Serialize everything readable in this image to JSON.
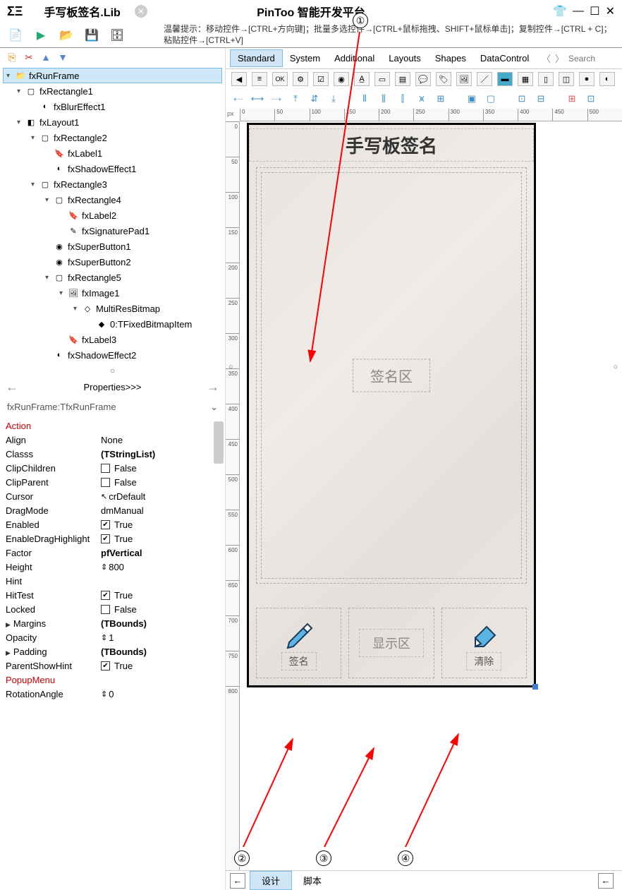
{
  "titlebar": {
    "file": "手写板签名.Lib",
    "app": "PinToo 智能开发平台"
  },
  "hint": "温馨提示：移动控件→[CTRL+方向键]；批量多选控件→[CTRL+鼠标拖拽、SHIFT+鼠标单击]；复制控件→[CTRL + C]；粘贴控件→[CTRL+V]",
  "tree": [
    {
      "lvl": 0,
      "exp": "▾",
      "icon": "📁",
      "label": "fxRunFrame",
      "sel": true
    },
    {
      "lvl": 1,
      "exp": "▾",
      "icon": "▢",
      "label": "fxRectangle1"
    },
    {
      "lvl": 2,
      "exp": "",
      "icon": "◐",
      "label": "fxBlurEffect1"
    },
    {
      "lvl": 1,
      "exp": "▾",
      "icon": "◧",
      "label": "fxLayout1"
    },
    {
      "lvl": 2,
      "exp": "▾",
      "icon": "▢",
      "label": "fxRectangle2"
    },
    {
      "lvl": 3,
      "exp": "",
      "icon": "🔖",
      "label": "fxLabel1"
    },
    {
      "lvl": 3,
      "exp": "",
      "icon": "◐",
      "label": "fxShadowEffect1"
    },
    {
      "lvl": 2,
      "exp": "▾",
      "icon": "▢",
      "label": "fxRectangle3"
    },
    {
      "lvl": 3,
      "exp": "▾",
      "icon": "▢",
      "label": "fxRectangle4"
    },
    {
      "lvl": 4,
      "exp": "",
      "icon": "🔖",
      "label": "fxLabel2"
    },
    {
      "lvl": 4,
      "exp": "",
      "icon": "✎",
      "label": "fxSignaturePad1"
    },
    {
      "lvl": 3,
      "exp": "",
      "icon": "◉",
      "label": "fxSuperButton1"
    },
    {
      "lvl": 3,
      "exp": "",
      "icon": "◉",
      "label": "fxSuperButton2"
    },
    {
      "lvl": 3,
      "exp": "▾",
      "icon": "▢",
      "label": "fxRectangle5"
    },
    {
      "lvl": 4,
      "exp": "▾",
      "icon": "🖼",
      "label": "fxImage1"
    },
    {
      "lvl": 5,
      "exp": "▾",
      "icon": "◇",
      "label": "MultiResBitmap"
    },
    {
      "lvl": 6,
      "exp": "",
      "icon": "◆",
      "label": "0:TFixedBitmapItem"
    },
    {
      "lvl": 4,
      "exp": "",
      "icon": "🔖",
      "label": "fxLabel3"
    },
    {
      "lvl": 3,
      "exp": "",
      "icon": "◐",
      "label": "fxShadowEffect2"
    }
  ],
  "sep": "○",
  "propHeader": "Properties>>>",
  "inspector": "fxRunFrame:TfxRunFrame",
  "props": [
    {
      "name": "Action",
      "red": true
    },
    {
      "name": "Align",
      "val": "None"
    },
    {
      "name": "Classs",
      "val": "(TStringList)",
      "bold": true
    },
    {
      "name": "ClipChildren",
      "chk": false,
      "val": "False"
    },
    {
      "name": "ClipParent",
      "chk": false,
      "val": "False"
    },
    {
      "name": "Cursor",
      "ico": "↖",
      "val": "crDefault"
    },
    {
      "name": "DragMode",
      "val": "dmManual"
    },
    {
      "name": "Enabled",
      "chk": true,
      "val": "True"
    },
    {
      "name": "EnableDragHighlight",
      "chk": true,
      "val": "True"
    },
    {
      "name": "Factor",
      "val": "pfVertical",
      "bold": true
    },
    {
      "name": "Height",
      "ico": "⇕",
      "val": "800"
    },
    {
      "name": "Hint"
    },
    {
      "name": "HitTest",
      "chk": true,
      "val": "True"
    },
    {
      "name": "Locked",
      "chk": false,
      "val": "False"
    },
    {
      "name": "Margins",
      "exp": true,
      "val": "(TBounds)",
      "bold": true
    },
    {
      "name": "Opacity",
      "ico": "⇕",
      "val": "1"
    },
    {
      "name": "Padding",
      "exp": true,
      "val": "(TBounds)",
      "bold": true
    },
    {
      "name": "ParentShowHint",
      "chk": true,
      "val": "True"
    },
    {
      "name": "PopupMenu",
      "red": true
    },
    {
      "name": "RotationAngle",
      "ico": "⇕",
      "val": "0"
    }
  ],
  "tabs": [
    "Standard",
    "System",
    "Additional",
    "Layouts",
    "Shapes",
    "DataControl"
  ],
  "searchPlaceholder": "Search",
  "rulerH": [
    "0",
    "50",
    "100",
    "150",
    "200",
    "250",
    "300",
    "350",
    "400",
    "450",
    "500"
  ],
  "rulerV": [
    "0",
    "50",
    "100",
    "150",
    "200",
    "250",
    "300",
    "350",
    "400",
    "450",
    "500",
    "550",
    "600",
    "650",
    "700",
    "750",
    "800"
  ],
  "canvas": {
    "title": "手写板签名",
    "sigLabel": "签名区",
    "btnSign": "签名",
    "btnDisplay": "显示区",
    "btnClear": "清除"
  },
  "bottomTabs": {
    "design": "设计",
    "script": "脚本"
  },
  "annotations": {
    "n1": "①",
    "n2": "②",
    "n3": "③",
    "n4": "④"
  }
}
